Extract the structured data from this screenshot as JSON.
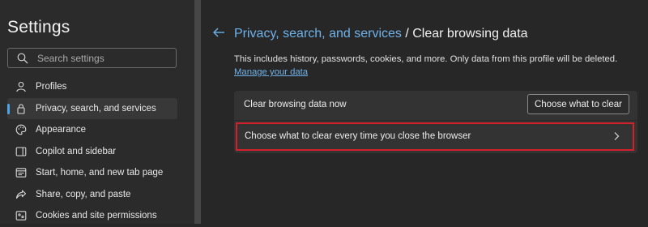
{
  "sidebar": {
    "title": "Settings",
    "search_placeholder": "Search settings",
    "items": [
      {
        "label": "Profiles",
        "icon": "person-icon"
      },
      {
        "label": "Privacy, search, and services",
        "icon": "lock-icon",
        "active": true
      },
      {
        "label": "Appearance",
        "icon": "palette-icon"
      },
      {
        "label": "Copilot and sidebar",
        "icon": "sidebar-icon"
      },
      {
        "label": "Start, home, and new tab page",
        "icon": "home-icon"
      },
      {
        "label": "Share, copy, and paste",
        "icon": "share-icon"
      },
      {
        "label": "Cookies and site permissions",
        "icon": "cookie-icon"
      }
    ]
  },
  "main": {
    "breadcrumb_parent": "Privacy, search, and services",
    "breadcrumb_separator": "/",
    "breadcrumb_current": "Clear browsing data",
    "description": "This includes history, passwords, cookies, and more. Only data from this profile will be deleted.",
    "manage_link": "Manage your data",
    "clear_now_label": "Clear browsing data now",
    "clear_button_label": "Choose what to clear",
    "on_close_label": "Choose what to clear every time you close the browser"
  },
  "colors": {
    "accent": "#4ca3e8",
    "link": "#6fb2ea",
    "highlight": "#d4202a",
    "background": "#272727"
  }
}
